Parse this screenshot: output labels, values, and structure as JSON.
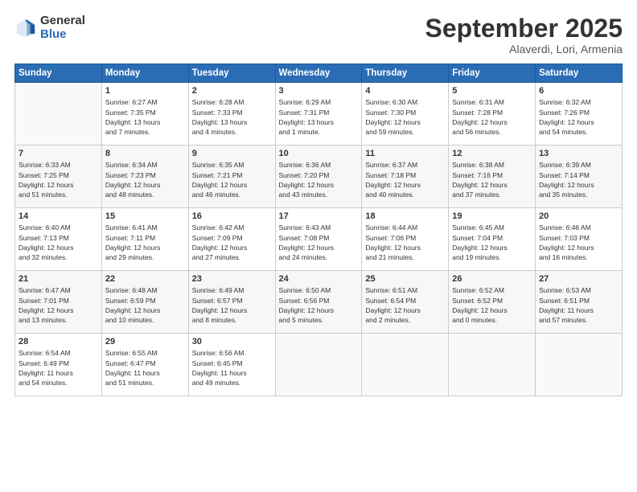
{
  "logo": {
    "general": "General",
    "blue": "Blue"
  },
  "header": {
    "month": "September 2025",
    "location": "Alaverdi, Lori, Armenia"
  },
  "days_of_week": [
    "Sunday",
    "Monday",
    "Tuesday",
    "Wednesday",
    "Thursday",
    "Friday",
    "Saturday"
  ],
  "weeks": [
    [
      {
        "day": "",
        "content": ""
      },
      {
        "day": "1",
        "content": "Sunrise: 6:27 AM\nSunset: 7:35 PM\nDaylight: 13 hours\nand 7 minutes."
      },
      {
        "day": "2",
        "content": "Sunrise: 6:28 AM\nSunset: 7:33 PM\nDaylight: 13 hours\nand 4 minutes."
      },
      {
        "day": "3",
        "content": "Sunrise: 6:29 AM\nSunset: 7:31 PM\nDaylight: 13 hours\nand 1 minute."
      },
      {
        "day": "4",
        "content": "Sunrise: 6:30 AM\nSunset: 7:30 PM\nDaylight: 12 hours\nand 59 minutes."
      },
      {
        "day": "5",
        "content": "Sunrise: 6:31 AM\nSunset: 7:28 PM\nDaylight: 12 hours\nand 56 minutes."
      },
      {
        "day": "6",
        "content": "Sunrise: 6:32 AM\nSunset: 7:26 PM\nDaylight: 12 hours\nand 54 minutes."
      }
    ],
    [
      {
        "day": "7",
        "content": "Sunrise: 6:33 AM\nSunset: 7:25 PM\nDaylight: 12 hours\nand 51 minutes."
      },
      {
        "day": "8",
        "content": "Sunrise: 6:34 AM\nSunset: 7:23 PM\nDaylight: 12 hours\nand 48 minutes."
      },
      {
        "day": "9",
        "content": "Sunrise: 6:35 AM\nSunset: 7:21 PM\nDaylight: 12 hours\nand 46 minutes."
      },
      {
        "day": "10",
        "content": "Sunrise: 6:36 AM\nSunset: 7:20 PM\nDaylight: 12 hours\nand 43 minutes."
      },
      {
        "day": "11",
        "content": "Sunrise: 6:37 AM\nSunset: 7:18 PM\nDaylight: 12 hours\nand 40 minutes."
      },
      {
        "day": "12",
        "content": "Sunrise: 6:38 AM\nSunset: 7:16 PM\nDaylight: 12 hours\nand 37 minutes."
      },
      {
        "day": "13",
        "content": "Sunrise: 6:39 AM\nSunset: 7:14 PM\nDaylight: 12 hours\nand 35 minutes."
      }
    ],
    [
      {
        "day": "14",
        "content": "Sunrise: 6:40 AM\nSunset: 7:13 PM\nDaylight: 12 hours\nand 32 minutes."
      },
      {
        "day": "15",
        "content": "Sunrise: 6:41 AM\nSunset: 7:11 PM\nDaylight: 12 hours\nand 29 minutes."
      },
      {
        "day": "16",
        "content": "Sunrise: 6:42 AM\nSunset: 7:09 PM\nDaylight: 12 hours\nand 27 minutes."
      },
      {
        "day": "17",
        "content": "Sunrise: 6:43 AM\nSunset: 7:08 PM\nDaylight: 12 hours\nand 24 minutes."
      },
      {
        "day": "18",
        "content": "Sunrise: 6:44 AM\nSunset: 7:06 PM\nDaylight: 12 hours\nand 21 minutes."
      },
      {
        "day": "19",
        "content": "Sunrise: 6:45 AM\nSunset: 7:04 PM\nDaylight: 12 hours\nand 19 minutes."
      },
      {
        "day": "20",
        "content": "Sunrise: 6:46 AM\nSunset: 7:03 PM\nDaylight: 12 hours\nand 16 minutes."
      }
    ],
    [
      {
        "day": "21",
        "content": "Sunrise: 6:47 AM\nSunset: 7:01 PM\nDaylight: 12 hours\nand 13 minutes."
      },
      {
        "day": "22",
        "content": "Sunrise: 6:48 AM\nSunset: 6:59 PM\nDaylight: 12 hours\nand 10 minutes."
      },
      {
        "day": "23",
        "content": "Sunrise: 6:49 AM\nSunset: 6:57 PM\nDaylight: 12 hours\nand 8 minutes."
      },
      {
        "day": "24",
        "content": "Sunrise: 6:50 AM\nSunset: 6:56 PM\nDaylight: 12 hours\nand 5 minutes."
      },
      {
        "day": "25",
        "content": "Sunrise: 6:51 AM\nSunset: 6:54 PM\nDaylight: 12 hours\nand 2 minutes."
      },
      {
        "day": "26",
        "content": "Sunrise: 6:52 AM\nSunset: 6:52 PM\nDaylight: 12 hours\nand 0 minutes."
      },
      {
        "day": "27",
        "content": "Sunrise: 6:53 AM\nSunset: 6:51 PM\nDaylight: 11 hours\nand 57 minutes."
      }
    ],
    [
      {
        "day": "28",
        "content": "Sunrise: 6:54 AM\nSunset: 6:49 PM\nDaylight: 11 hours\nand 54 minutes."
      },
      {
        "day": "29",
        "content": "Sunrise: 6:55 AM\nSunset: 6:47 PM\nDaylight: 11 hours\nand 51 minutes."
      },
      {
        "day": "30",
        "content": "Sunrise: 6:56 AM\nSunset: 6:45 PM\nDaylight: 11 hours\nand 49 minutes."
      },
      {
        "day": "",
        "content": ""
      },
      {
        "day": "",
        "content": ""
      },
      {
        "day": "",
        "content": ""
      },
      {
        "day": "",
        "content": ""
      }
    ]
  ]
}
